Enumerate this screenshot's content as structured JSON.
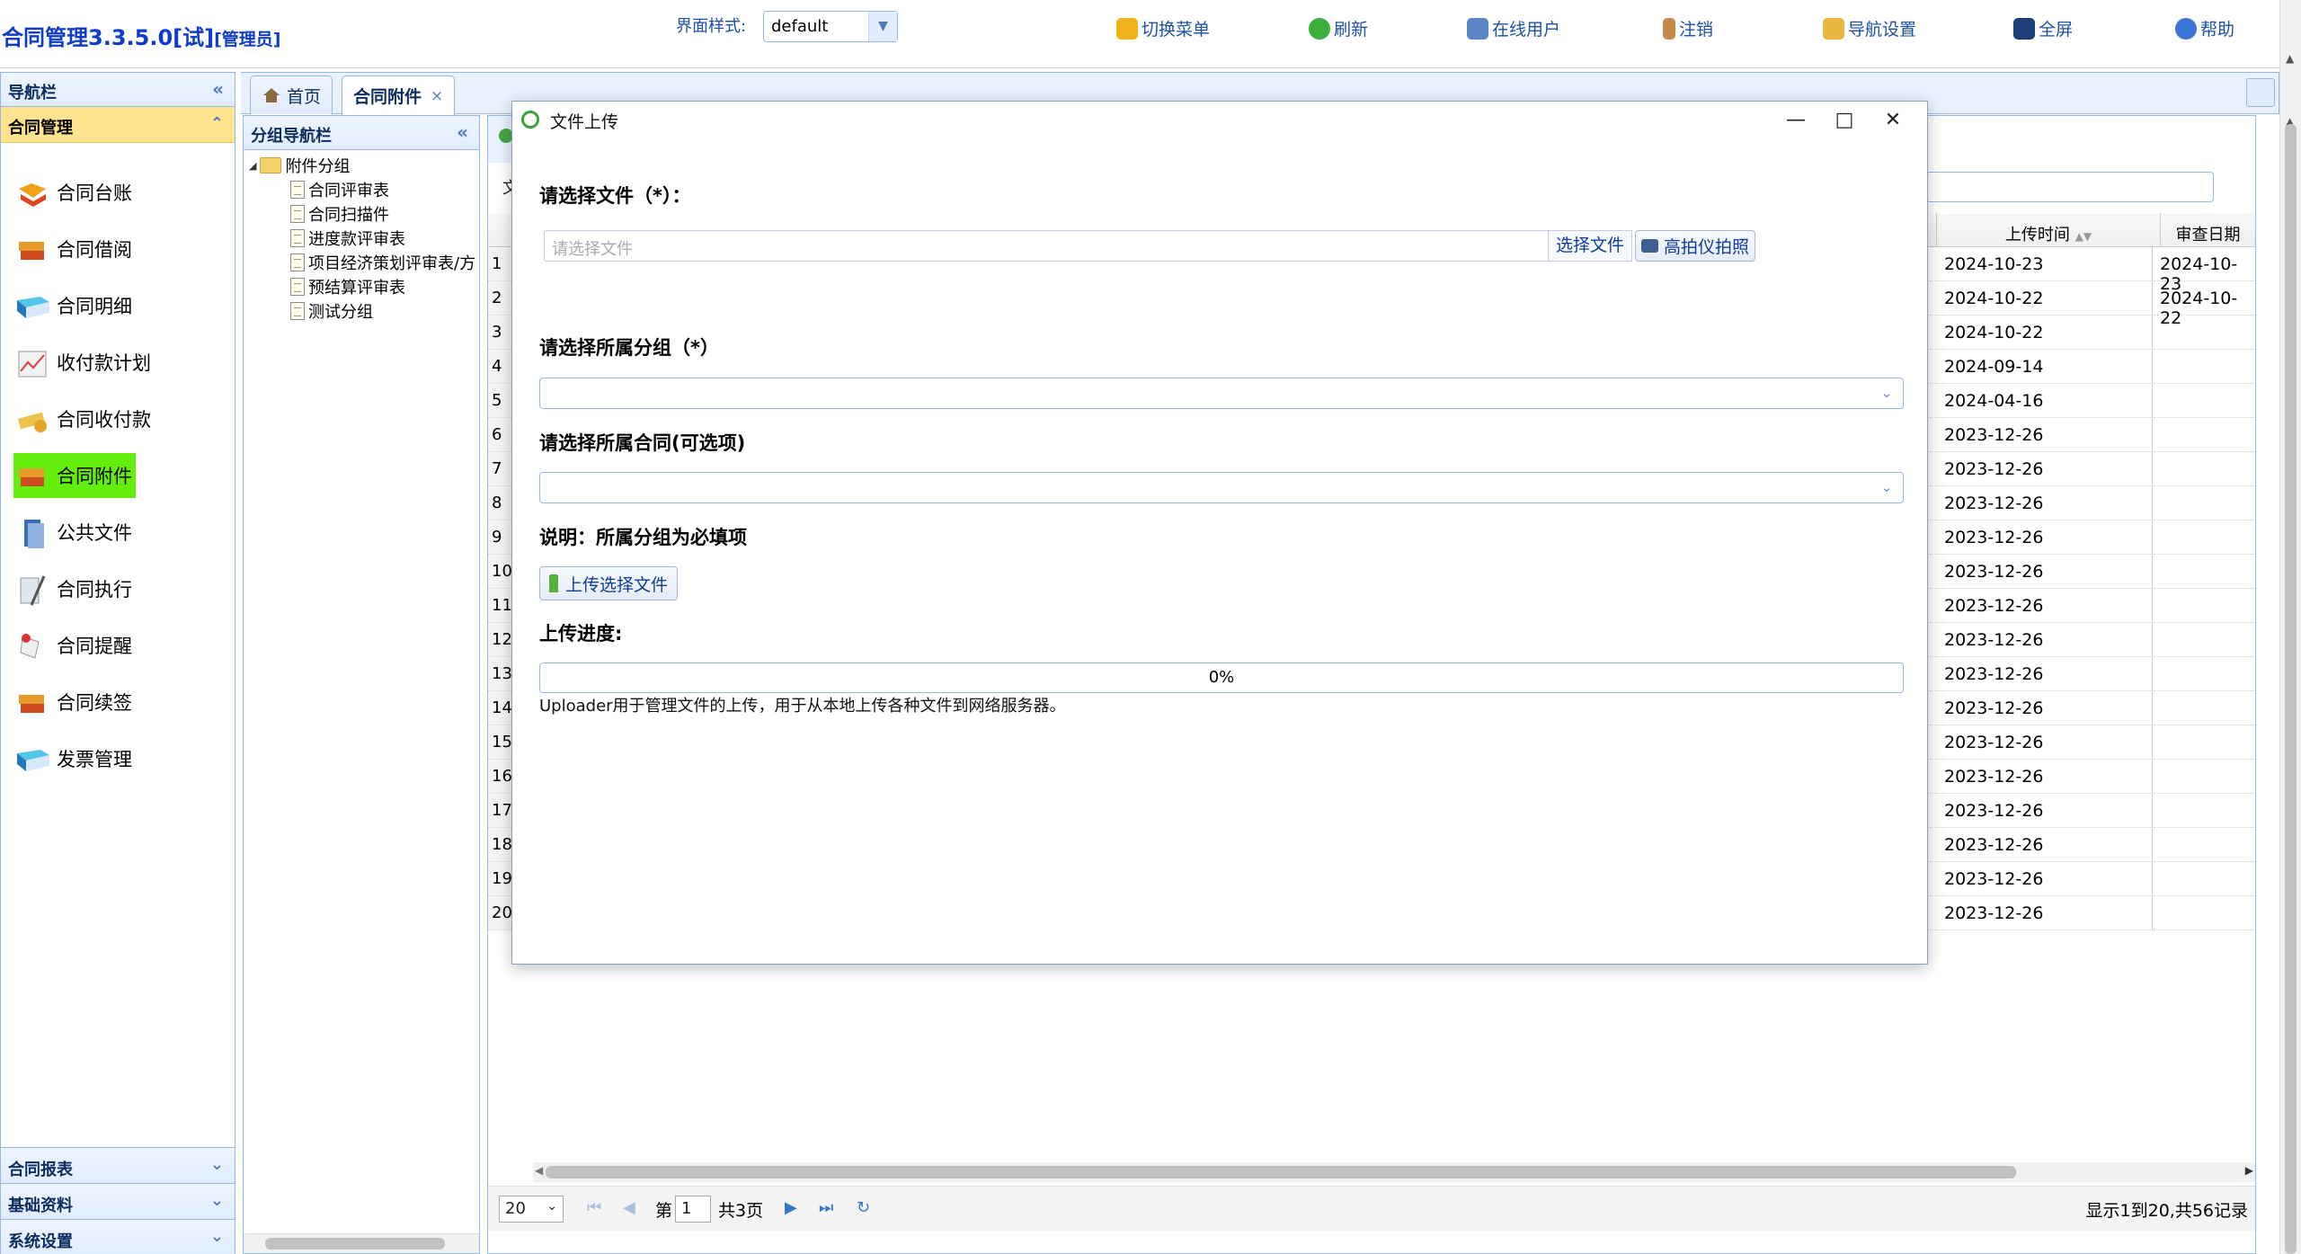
{
  "app": {
    "title": "合同管理3.3.5.0[试]",
    "role": "[管理员]",
    "style_label": "界面样式:",
    "style_value": "default"
  },
  "topbar": {
    "switch_menu": "切换菜单",
    "refresh": "刷新",
    "online_users": "在线用户",
    "logout": "注销",
    "nav_settings": "导航设置",
    "fullscreen": "全屏",
    "help": "帮助"
  },
  "leftnav": {
    "title": "导航栏",
    "section": "合同管理",
    "items": [
      {
        "label": "合同台账",
        "icon": "ledger-icon"
      },
      {
        "label": "合同借阅",
        "icon": "borrow-icon"
      },
      {
        "label": "合同明细",
        "icon": "detail-icon"
      },
      {
        "label": "收付款计划",
        "icon": "chart-icon"
      },
      {
        "label": "合同收付款",
        "icon": "payment-icon"
      },
      {
        "label": "合同附件",
        "icon": "attachment-icon"
      },
      {
        "label": "公共文件",
        "icon": "public-file-icon"
      },
      {
        "label": "合同执行",
        "icon": "execute-icon"
      },
      {
        "label": "合同提醒",
        "icon": "reminder-icon"
      },
      {
        "label": "合同续签",
        "icon": "renew-icon"
      },
      {
        "label": "发票管理",
        "icon": "invoice-icon"
      }
    ],
    "bottom_sections": [
      "合同报表",
      "基础资料",
      "系统设置"
    ]
  },
  "tabs": [
    {
      "label": "首页"
    },
    {
      "label": "合同附件",
      "close": "×"
    }
  ],
  "group_tree": {
    "title": "分组导航栏",
    "root": "附件分组",
    "children": [
      "合同评审表",
      "合同扫描件",
      "进度款评审表",
      "项目经济策划评审表/方",
      "预结算评审表",
      "测试分组"
    ]
  },
  "grid": {
    "columns": {
      "upload_time": "上传时间",
      "review_date": "审查日期"
    },
    "rows": [
      {
        "n": "1",
        "upload": "2024-10-23",
        "review": "2024-10-23"
      },
      {
        "n": "2",
        "upload": "2024-10-22",
        "review": "2024-10-22"
      },
      {
        "n": "3",
        "upload": "2024-10-22",
        "review": ""
      },
      {
        "n": "4",
        "upload": "2024-09-14",
        "review": ""
      },
      {
        "n": "5",
        "upload": "2024-04-16",
        "review": ""
      },
      {
        "n": "6",
        "upload": "2023-12-26",
        "review": ""
      },
      {
        "n": "7",
        "upload": "2023-12-26",
        "review": ""
      },
      {
        "n": "8",
        "upload": "2023-12-26",
        "review": ""
      },
      {
        "n": "9",
        "upload": "2023-12-26",
        "review": ""
      },
      {
        "n": "10",
        "upload": "2023-12-26",
        "review": ""
      },
      {
        "n": "11",
        "upload": "2023-12-26",
        "review": ""
      },
      {
        "n": "12",
        "upload": "2023-12-26",
        "review": ""
      },
      {
        "n": "13",
        "upload": "2023-12-26",
        "review": ""
      },
      {
        "n": "14",
        "upload": "2023-12-26",
        "review": ""
      },
      {
        "n": "15",
        "upload": "2023-12-26",
        "review": ""
      },
      {
        "n": "16",
        "upload": "2023-12-26",
        "review": ""
      },
      {
        "n": "17",
        "upload": "2023-12-26",
        "review": ""
      },
      {
        "n": "18",
        "upload": "2023-12-26",
        "review": ""
      },
      {
        "n": "19",
        "upload": "2023-12-26",
        "review": ""
      },
      {
        "n": "20",
        "upload": "2023-12-26",
        "review": ""
      }
    ],
    "toolbar_letter": "文"
  },
  "pager": {
    "page_size": "20",
    "page_prefix": "第",
    "page_number": "1",
    "page_total": "共3页",
    "summary": "显示1到20,共56记录"
  },
  "dialog": {
    "title": "文件上传",
    "select_file_label": "请选择文件（*）：",
    "file_placeholder": "请选择文件",
    "pick_file": "选择文件",
    "scanner": "高拍仪拍照",
    "group_label": "请选择所属分组（*）",
    "contract_label": "请选择所属合同(可选项)",
    "note": "说明：所属分组为必填项",
    "upload_btn": "上传选择文件",
    "progress_label": "上传进度:",
    "progress_text": "0%",
    "progress_value": 0,
    "description": "Uploader用于管理文件的上传，用于从本地上传各种文件到网络服务器。"
  }
}
